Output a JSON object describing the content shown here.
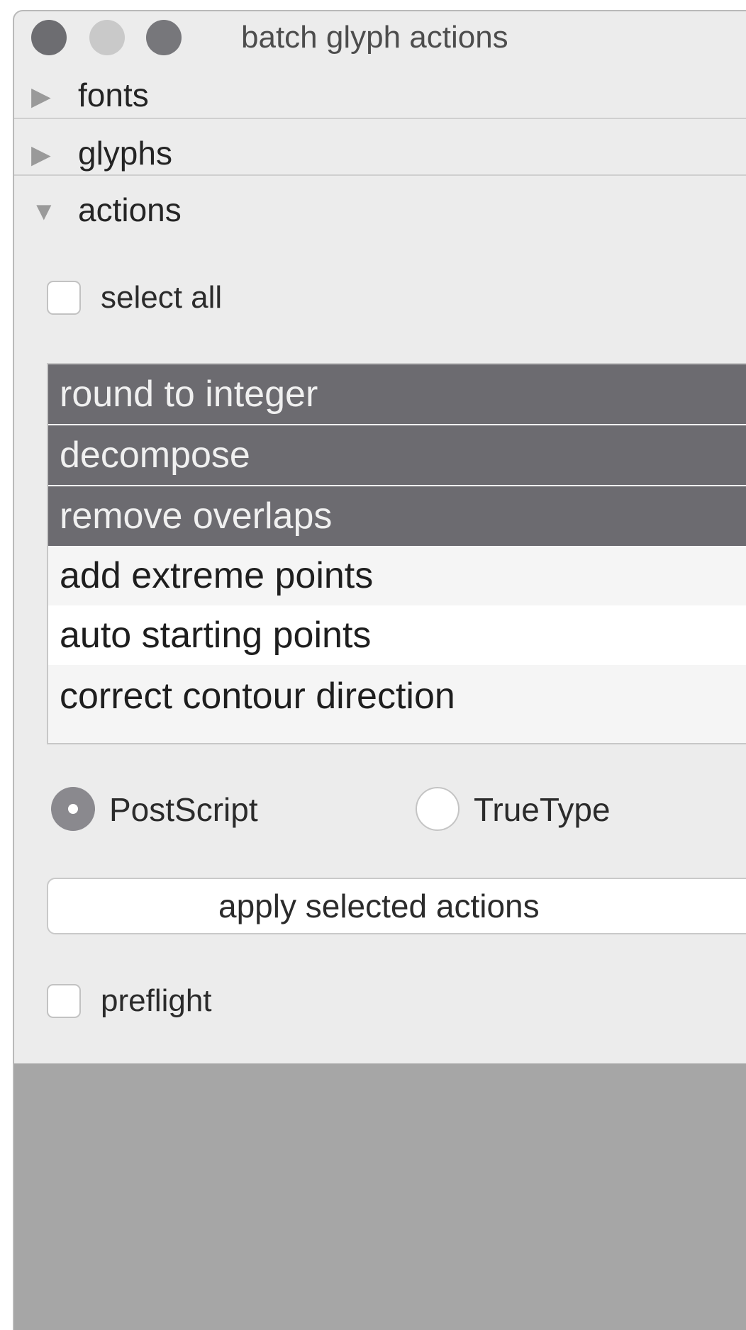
{
  "window": {
    "title": "batch glyph actions"
  },
  "sections": [
    {
      "label": "fonts",
      "expanded": false
    },
    {
      "label": "glyphs",
      "expanded": false
    },
    {
      "label": "actions",
      "expanded": true
    }
  ],
  "icons": {
    "collapsed": "▶",
    "expanded": "▼"
  },
  "select_all": {
    "label": "select all",
    "checked": false
  },
  "actions_list": {
    "items": [
      {
        "label": "round to integer",
        "selected": true
      },
      {
        "label": "decompose",
        "selected": true
      },
      {
        "label": "remove overlaps",
        "selected": true
      },
      {
        "label": "add extreme points",
        "selected": false
      },
      {
        "label": "auto starting points",
        "selected": false
      },
      {
        "label": "correct contour direction",
        "selected": false
      }
    ]
  },
  "format": {
    "options": [
      {
        "label": "PostScript",
        "selected": true
      },
      {
        "label": "TrueType",
        "selected": false
      }
    ]
  },
  "apply_button": {
    "label": "apply selected actions"
  },
  "preflight": {
    "label": "preflight",
    "checked": false
  },
  "colors": {
    "selected_row": "#6c6b70",
    "window_bg": "#ececec",
    "status_bar": "#a6a6a6"
  }
}
